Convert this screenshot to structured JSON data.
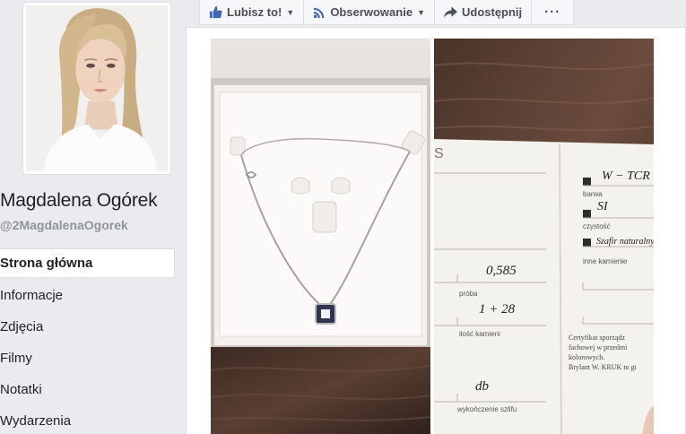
{
  "page": {
    "name": "Magdalena Ogórek",
    "handle": "@2MagdalenaOgorek"
  },
  "nav": {
    "items": [
      {
        "label": "Strona główna",
        "active": true
      },
      {
        "label": "Informacje"
      },
      {
        "label": "Zdjęcia"
      },
      {
        "label": "Filmy"
      },
      {
        "label": "Notatki"
      },
      {
        "label": "Wydarzenia"
      }
    ]
  },
  "actions": {
    "like": "Lubisz to!",
    "follow": "Obserwowanie",
    "share": "Udostępnij",
    "more": "···"
  },
  "certificate": {
    "s_letter": "S",
    "color_value": "W − TCR",
    "color_label": "barwa",
    "clarity_value": "SI",
    "clarity_label": "czystość",
    "stones_value": "Szafir naturalny",
    "stones_label": "inne kamienie",
    "assay_value": "0,585",
    "assay_label": "próba",
    "count_value": "1 + 28",
    "count_label": "ilość kamieni",
    "finish_value": "db",
    "finish_label": "wykończenie szlifu",
    "cert_line1": "Certyfikat sporządz",
    "cert_line2": "fachowej w przedmi",
    "cert_line3": "kolorowych.",
    "cert_line4": "Brylant W. KRUK to gi"
  },
  "colors": {
    "accent": "#4267b2",
    "link": "#365899",
    "text": "#1d2129",
    "muted": "#90949c",
    "background": "#e9ebee"
  }
}
